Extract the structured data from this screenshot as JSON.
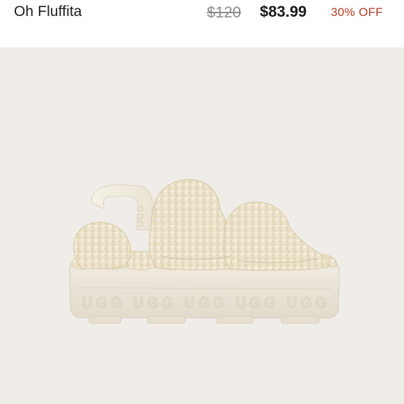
{
  "product": {
    "title": "Oh Fluffita",
    "original_price": "$120",
    "sale_price": "$83.99",
    "discount_label": "30% OFF"
  },
  "image": {
    "sole_brand_text": "UGG UGG UGG UGG UGG",
    "strap_brand_text": "UGG",
    "colors": {
      "background": "#f0ede8",
      "fleece": "#ece3cb",
      "sole": "#ece6d9",
      "discount": "#b23a22"
    }
  }
}
